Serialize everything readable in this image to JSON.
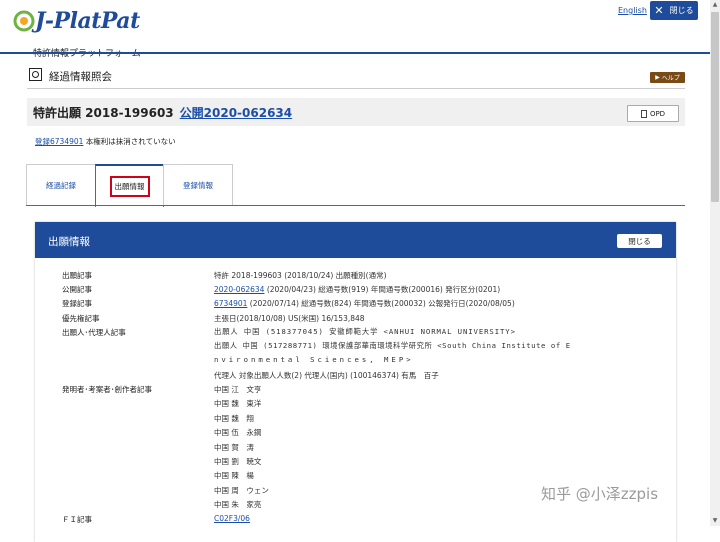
{
  "header": {
    "logo_text": "J-PlatPat",
    "logo_subtitle": "特許情報プラットフォーム",
    "lang_link": "English",
    "close_label": "閉じる"
  },
  "page": {
    "title": "経過情報照会",
    "help_label": "ヘルプ"
  },
  "record": {
    "title": "特許出願 2018-199603",
    "pub_link": "公開2020-062634",
    "opd_label": "OPD",
    "reg_link": "登録6734901",
    "status_text": "本権利は抹消されていない"
  },
  "tabs": [
    {
      "label": "経過記録"
    },
    {
      "label": "出願情報"
    },
    {
      "label": "登録情報"
    }
  ],
  "panel": {
    "title": "出願情報",
    "close_label": "閉じる",
    "rows": {
      "app_label": "出願記事",
      "app_value": "特許 2018-199603 (2018/10/24) 出願種別(通常)",
      "pub_label": "公開記事",
      "pub_link": "2020-062634",
      "pub_rest": " (2020/04/23) 総通号数(919) 年間通号数(200016) 発行区分(0201)",
      "reg_label": "登録記事",
      "reg_link": "6734901",
      "reg_rest": " (2020/07/14) 総通号数(824) 年間通号数(200032) 公報発行日(2020/08/05)",
      "prio_label": "優先権記事",
      "prio_value": "主張日(2018/10/08) US(米国) 16/153,848",
      "applicant_label": "出願人･代理人記事",
      "applicant_1": "出願人 中国 (518377045) 安徽師範大学 <ANHUI NORMAL UNIVERSITY>",
      "applicant_2a": "出願人 中国 (517288771) 環境保護部華南環境科学研究所 <South China Institute of E",
      "applicant_2b": "nvironmental Sciences, MEP>",
      "agent": "代理人 対象出願人人数(2) 代理人(国内) (100146374) 有馬　百子",
      "inventor_label": "発明者･考案者･創作者記事",
      "inventors": [
        "中国 江　文亨",
        "中国 魏　東洋",
        "中国 魏　翔",
        "中国 伍　永鋼",
        "中国 賀　涛",
        "中国 劉　暁文",
        "中国 陳　楊",
        "中国 周　ウェン",
        "中国 朱　家亮"
      ],
      "fi_label": "ＦＩ記事",
      "fi_link": "C02F3/06"
    }
  },
  "watermark": "知乎 @小泽zzpis"
}
